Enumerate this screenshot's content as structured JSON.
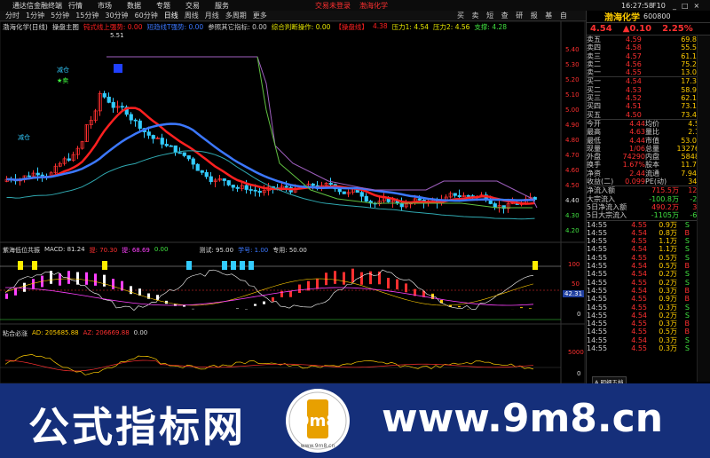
{
  "titlebar": {
    "app": "通达信金融终端",
    "menus": [
      "行情",
      "市场",
      "数据",
      "专题",
      "交易",
      "服务"
    ],
    "alert1": "交易未登录",
    "alert2": "渤海化学",
    "time": "16:27:58",
    "ctrl": "F10"
  },
  "toolbar": {
    "periods": [
      "分时",
      "1分钟",
      "5分钟",
      "15分钟",
      "30分钟",
      "60分钟",
      "日线",
      "周线",
      "月线",
      "多周期",
      "更多"
    ],
    "active": "日线",
    "right": [
      "买",
      "卖",
      "短",
      "查",
      "研",
      "报",
      "基",
      "自"
    ]
  },
  "main": {
    "stock": "渤海化学(日线)",
    "panel": "操盘主图",
    "indicators": [
      {
        "text": "钝式线上强势: 0.00",
        "color": "#ff2020"
      },
      {
        "text": "短趋线T强势: 0.00",
        "color": "#3c78ff"
      },
      {
        "text": "参照其它指标: 0.00",
        "color": "#cccccc"
      },
      {
        "text": "综合判断操作: 0.00",
        "color": "#e6e600"
      },
      {
        "text": "【操盘线】",
        "color": "#ff2020"
      },
      {
        "text": "4.38",
        "color": "#ff2020"
      },
      {
        "text": "压力1: 4.54",
        "color": "#e6e600"
      },
      {
        "text": "压力2: 4.56",
        "color": "#e6e600"
      },
      {
        "text": "支撑: 4.28",
        "color": "#40e040"
      }
    ],
    "price_top": "5.51",
    "sell_mark": "★卖",
    "sell_mark2": "减仓",
    "buy_mark": "减仓",
    "axis": [
      "5.40",
      "5.30",
      "5.20",
      "5.10",
      "5.00",
      "4.90",
      "4.80",
      "4.70",
      "4.60",
      "4.50",
      "4.40",
      "4.30",
      "4.20"
    ]
  },
  "macd": {
    "name": "紫海低位共振",
    "label": "MACD: 81.24",
    "label2": "提: 70.30",
    "label3": "提: 68.69",
    "label4": "0.00",
    "label5": "测试: 95.00",
    "label6": "学号: 1.00",
    "label7": "专用: 50.00",
    "axis": [
      "100",
      "50",
      "0"
    ],
    "tag": "42.31"
  },
  "sub": {
    "name": "粘合必涨",
    "label": "AD: 205685.88",
    "label2": "AZ: 206669.88",
    "label3": "0.00",
    "axis": [
      "5000",
      "0"
    ]
  },
  "quote": {
    "name": "渤海化学",
    "code": "600800",
    "price": "4.54",
    "change": "▲0.10",
    "pct": "2.25%",
    "asks": [
      [
        "卖五",
        "4.59",
        "69.8万"
      ],
      [
        "卖四",
        "4.58",
        "55.5万"
      ],
      [
        "卖三",
        "4.57",
        "61.1万"
      ],
      [
        "卖二",
        "4.56",
        "75.2万"
      ],
      [
        "卖一",
        "4.55",
        "13.0万"
      ]
    ],
    "bids": [
      [
        "买一",
        "4.54",
        "17.3万"
      ],
      [
        "买二",
        "4.53",
        "58.9万"
      ],
      [
        "买三",
        "4.52",
        "62.1万"
      ],
      [
        "买四",
        "4.51",
        "73.1万"
      ],
      [
        "买五",
        "4.50",
        "73.4万"
      ]
    ],
    "stats": [
      [
        "今开",
        "4.44",
        "均价",
        "4.55"
      ],
      [
        "最高",
        "4.63",
        "量比",
        "2.13"
      ],
      [
        "最低",
        "4.44",
        "市值",
        "53.0亿"
      ],
      [
        "现量",
        "1/06",
        "总量",
        "132769"
      ],
      [
        "外盘",
        "74290",
        "内盘",
        "58489"
      ],
      [
        "换手",
        "1.67%",
        "股本",
        "11.7亿"
      ],
      [
        "净资",
        "2.44",
        "流通",
        "7.94亿"
      ],
      [
        "收益(二)",
        "0.099",
        "PE(动)",
        "34.4"
      ]
    ],
    "flows": [
      [
        "净流入额",
        "715.5万",
        "12%"
      ],
      [
        "大宗流入",
        "-100.8万",
        "-2%"
      ],
      [
        "5日净流入额",
        "490.2万",
        "3%"
      ],
      [
        "5日大宗流入",
        "-1105万",
        "-6%"
      ]
    ],
    "ticks": [
      [
        "14:55",
        "4.55",
        "0.9万",
        "S",
        "1"
      ],
      [
        "14:55",
        "4.54",
        "0.8万",
        "B",
        "1"
      ],
      [
        "14:55",
        "4.55",
        "1.1万",
        "S",
        "1"
      ],
      [
        "14:55",
        "4.54",
        "1.1万",
        "S",
        "1"
      ],
      [
        "14:55",
        "4.55",
        "0.5万",
        "S",
        "1"
      ],
      [
        "14:55",
        "4.54",
        "0.5万",
        "B",
        "1"
      ],
      [
        "14:55",
        "4.54",
        "0.2万",
        "S",
        "1"
      ],
      [
        "14:55",
        "4.55",
        "0.2万",
        "S",
        "1"
      ],
      [
        "14:55",
        "4.54",
        "0.3万",
        "B",
        "1"
      ],
      [
        "14:55",
        "4.55",
        "0.9万",
        "B",
        "1"
      ],
      [
        "14:55",
        "4.55",
        "0.3万",
        "S",
        "1"
      ],
      [
        "14:55",
        "4.54",
        "0.2万",
        "S",
        "1"
      ],
      [
        "14:55",
        "4.55",
        "0.3万",
        "B",
        "1"
      ],
      [
        "14:55",
        "4.55",
        "0.5万",
        "B",
        "1"
      ],
      [
        "14:55",
        "4.54",
        "0.3万",
        "S",
        "1"
      ],
      [
        "14:55",
        "4.55",
        "0.3万",
        "S",
        "1"
      ]
    ],
    "bottom_tab": "A 明细五档"
  },
  "banner": {
    "title": "公式指标网",
    "url": "www.9m8.cn",
    "logo": "9m8",
    "logo_url": "www.9m8.cn"
  }
}
